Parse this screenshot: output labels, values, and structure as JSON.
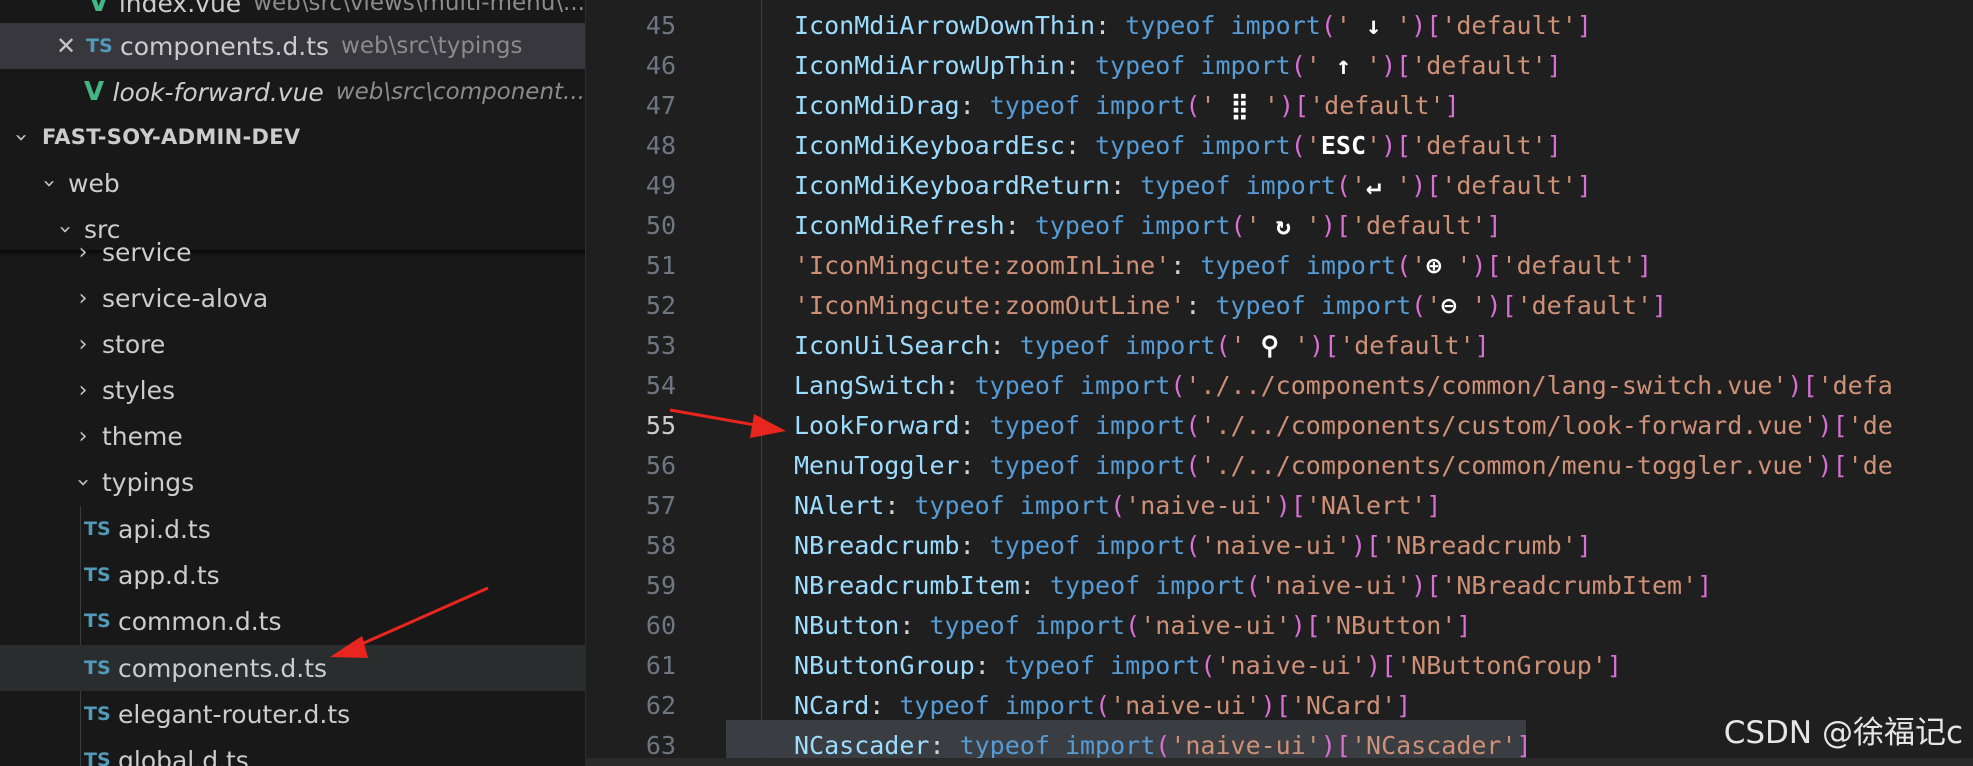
{
  "explorer": {
    "open_editors": [
      {
        "name": "index.vue",
        "desc": "web\\src\\views\\multi-menu\\...",
        "icon": "vue-icon"
      },
      {
        "name": "components.d.ts",
        "desc": "web\\src\\typings",
        "icon": "ts-icon",
        "close": "✕"
      },
      {
        "name": "look-forward.vue",
        "desc": "web\\src\\component...",
        "icon": "vue-icon"
      }
    ],
    "project_title": "FAST-SOY-ADMIN-DEV",
    "tree": [
      {
        "label": "web",
        "type": "folder-open"
      },
      {
        "label": "src",
        "type": "folder-open"
      },
      {
        "label": "service",
        "type": "folder"
      },
      {
        "label": "service-alova",
        "type": "folder"
      },
      {
        "label": "store",
        "type": "folder"
      },
      {
        "label": "styles",
        "type": "folder"
      },
      {
        "label": "theme",
        "type": "folder"
      },
      {
        "label": "typings",
        "type": "folder-open"
      },
      {
        "label": "api.d.ts",
        "type": "file"
      },
      {
        "label": "app.d.ts",
        "type": "file"
      },
      {
        "label": "common.d.ts",
        "type": "file"
      },
      {
        "label": "components.d.ts",
        "type": "file"
      },
      {
        "label": "elegant-router.d.ts",
        "type": "file"
      },
      {
        "label": "global.d.ts",
        "type": "file"
      }
    ],
    "ts_badge": "TS",
    "vue_badge": "V"
  },
  "editor": {
    "active_line": "55",
    "lines": [
      {
        "n": "45",
        "name": "IconMdiArrowDownThin",
        "glyph": " ↓ ",
        "target": "'default'"
      },
      {
        "n": "46",
        "name": "IconMdiArrowUpThin",
        "glyph": " ↑ ",
        "target": "'default'"
      },
      {
        "n": "47",
        "name": "IconMdiDrag",
        "glyph": " ⣿ ",
        "target": "'default'"
      },
      {
        "n": "48",
        "name": "IconMdiKeyboardEsc",
        "glyph": "ESC",
        "target": "'default'"
      },
      {
        "n": "49",
        "name": "IconMdiKeyboardReturn",
        "glyph": "↵ ",
        "target": "'default'"
      },
      {
        "n": "50",
        "name": "IconMdiRefresh",
        "glyph": " ↻ ",
        "target": "'default'"
      },
      {
        "n": "51",
        "name": "'IconMingcute:zoomInLine'",
        "glyph": "⊕ ",
        "target": "'default'"
      },
      {
        "n": "52",
        "name": "'IconMingcute:zoomOutLine'",
        "glyph": "⊖ ",
        "target": "'default'"
      },
      {
        "n": "53",
        "name": "IconUilSearch",
        "glyph": " ⚲ ",
        "target": "'default'"
      },
      {
        "n": "54",
        "name": "LangSwitch",
        "path": "'./../components/common/lang-switch.vue'",
        "target": "'defa"
      },
      {
        "n": "55",
        "name": "LookForward",
        "path": "'./../components/custom/look-forward.vue'",
        "target": "'de"
      },
      {
        "n": "56",
        "name": "MenuToggler",
        "path": "'./../components/common/menu-toggler.vue'",
        "target": "'de"
      },
      {
        "n": "57",
        "name": "NAlert",
        "path": "'naive-ui'",
        "target": "'NAlert'"
      },
      {
        "n": "58",
        "name": "NBreadcrumb",
        "path": "'naive-ui'",
        "target": "'NBreadcrumb'"
      },
      {
        "n": "59",
        "name": "NBreadcrumbItem",
        "path": "'naive-ui'",
        "target": "'NBreadcrumbItem'"
      },
      {
        "n": "60",
        "name": "NButton",
        "path": "'naive-ui'",
        "target": "'NButton'"
      },
      {
        "n": "61",
        "name": "NButtonGroup",
        "path": "'naive-ui'",
        "target": "'NButtonGroup'"
      },
      {
        "n": "62",
        "name": "NCard",
        "path": "'naive-ui'",
        "target": "'NCard'"
      },
      {
        "n": "63",
        "name": "NCascader",
        "path": "'naive-ui'",
        "target": "'NCascader'"
      }
    ],
    "kw_typeof": "typeof",
    "kw_import": "import"
  },
  "watermark": "CSDN @徐福记c",
  "colors": {
    "annotation_arrow": "#e8261f",
    "ts_badge": "#519aba",
    "vue_badge": "#41b883"
  }
}
